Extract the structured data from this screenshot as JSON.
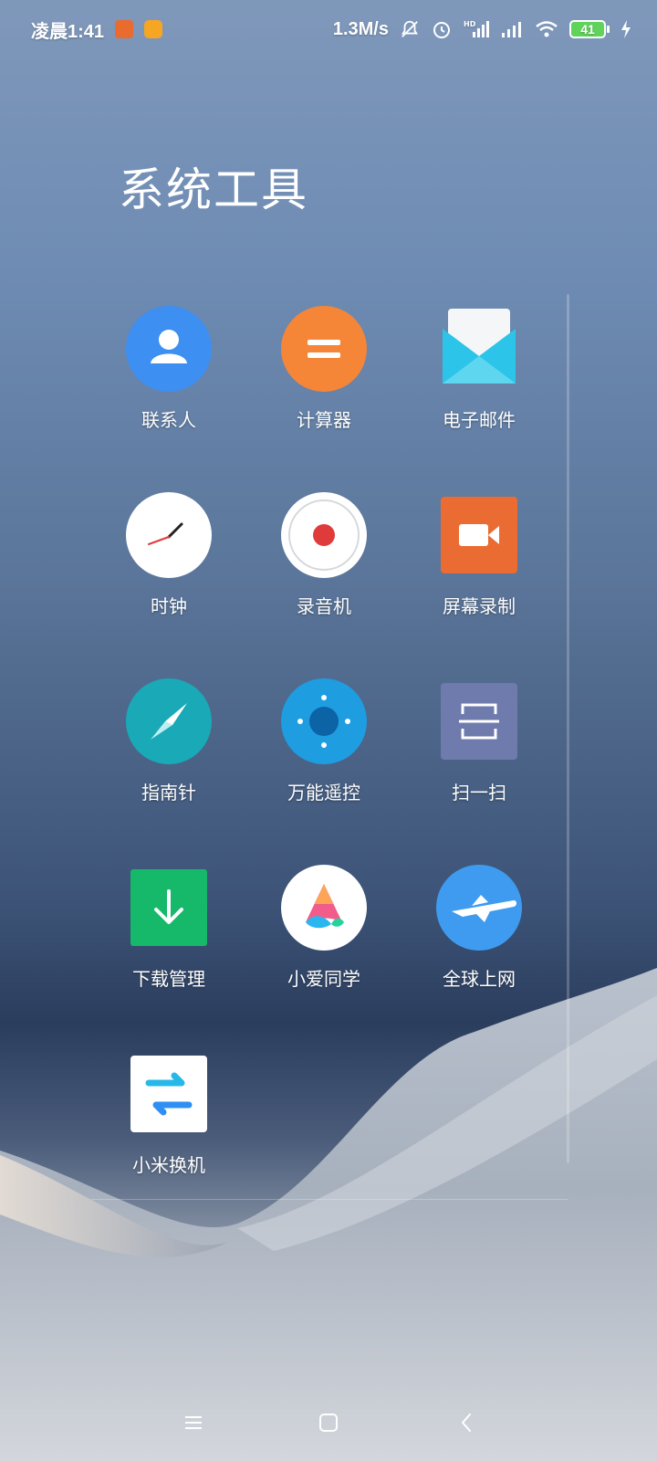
{
  "status_bar": {
    "time": "凌晨1:41",
    "net_speed": "1.3M/s",
    "battery": "41",
    "icons": [
      "screen-record-app-icon",
      "yellow-app-icon",
      "silent-bell-icon",
      "alarm-icon",
      "hd-signal-icon",
      "signal-icon",
      "wifi-icon",
      "battery-icon",
      "charging-icon"
    ],
    "colors": {
      "record": "#e96b2e",
      "yellow_app": "#f6a623",
      "battery_fill": "#5fd35a"
    }
  },
  "folder": {
    "title": "系统工具",
    "apps": [
      {
        "label": "联系人",
        "icon": "contacts-icon",
        "color": "#3d8ff2"
      },
      {
        "label": "计算器",
        "icon": "calculator-icon",
        "color": "#f58638"
      },
      {
        "label": "电子邮件",
        "icon": "email-icon",
        "color": "#2cc4e8"
      },
      {
        "label": "时钟",
        "icon": "clock-icon",
        "color": "#ffffff"
      },
      {
        "label": "录音机",
        "icon": "recorder-icon",
        "color": "#e03b3b"
      },
      {
        "label": "屏幕录制",
        "icon": "screen-record-icon",
        "color": "#ea6c32"
      },
      {
        "label": "指南针",
        "icon": "compass-icon",
        "color": "#1aa9b7"
      },
      {
        "label": "万能遥控",
        "icon": "remote-control-icon",
        "color": "#1e9de0"
      },
      {
        "label": "扫一扫",
        "icon": "scanner-icon",
        "color": "#6f7aad"
      },
      {
        "label": "下载管理",
        "icon": "download-icon",
        "color": "#16b86a"
      },
      {
        "label": "小爱同学",
        "icon": "xiaoai-icon",
        "color": "#ffffff"
      },
      {
        "label": "全球上网",
        "icon": "airplane-icon",
        "color": "#3e9bf0"
      },
      {
        "label": "小米换机",
        "icon": "transfer-icon",
        "color": "#ffffff"
      }
    ]
  },
  "nav": {
    "buttons": [
      "menu-icon",
      "home-icon",
      "back-icon"
    ]
  }
}
